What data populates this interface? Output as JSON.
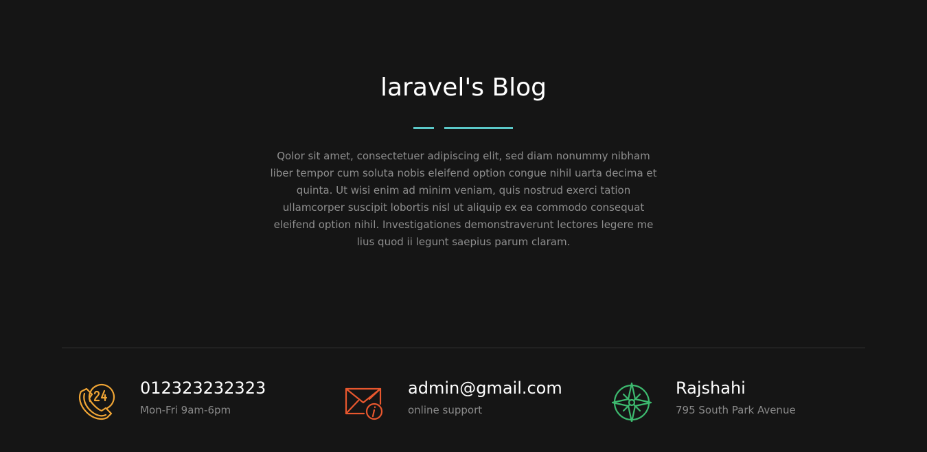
{
  "blog": {
    "title": "laravel's Blog",
    "description": "Qolor sit amet, consectetuer adipiscing elit, sed diam nonummy nibham liber tempor cum soluta nobis eleifend option congue nihil uarta decima et quinta. Ut wisi enim ad minim veniam, quis nostrud exerci tation ullamcorper suscipit lobortis nisl ut aliquip ex ea commodo consequat eleifend option nihil. Investigationes demonstraverunt lectores legere me lius quod ii legunt saepius parum claram."
  },
  "colors": {
    "background": "#151515",
    "accent": "#5bc8c8",
    "phone_icon": "#f0a535",
    "mail_icon": "#e8572e",
    "location_icon": "#3dba6f"
  },
  "contacts": [
    {
      "icon": "phone-24-icon",
      "value": "012323232323",
      "detail": "Mon-Fri 9am-6pm"
    },
    {
      "icon": "mail-info-icon",
      "value": "admin@gmail.com",
      "detail": "online support"
    },
    {
      "icon": "compass-icon",
      "value": "Rajshahi",
      "detail": "795 South Park Avenue"
    }
  ]
}
